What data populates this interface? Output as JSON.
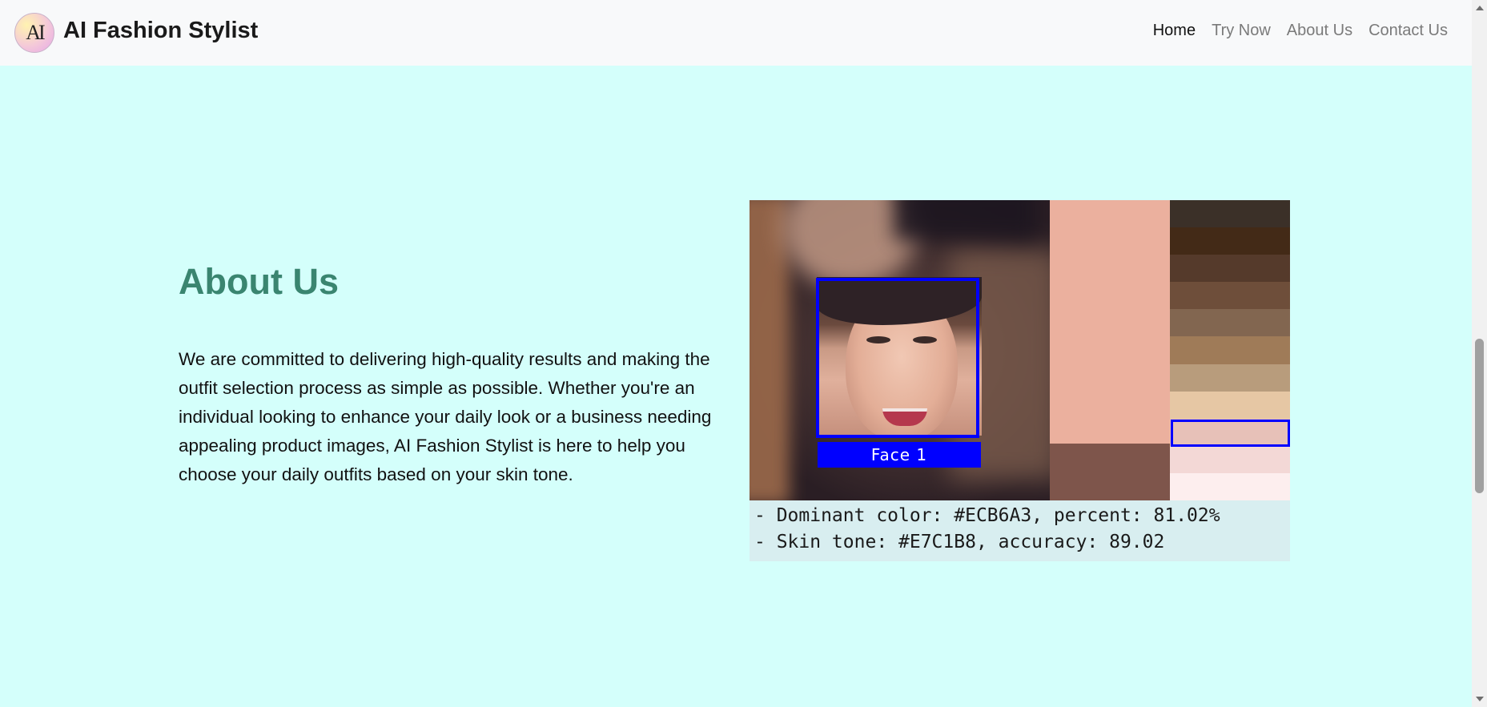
{
  "header": {
    "logo_text": "AI",
    "brand": "AI Fashion Stylist",
    "nav": [
      {
        "label": "Home",
        "active": true
      },
      {
        "label": "Try Now",
        "active": false
      },
      {
        "label": "About Us",
        "active": false
      },
      {
        "label": "Contact Us",
        "active": false
      }
    ]
  },
  "about": {
    "heading": "About Us",
    "paragraph": "We are committed to delivering high-quality results and making the outfit selection process as simple as possible. Whether you're an individual looking to enhance your daily look or a business needing appealing product images, AI Fashion Stylist is here to help you choose your daily outfits based on your skin tone."
  },
  "analysis": {
    "face_label": "Face 1",
    "dominant_color": "#ECB6A3",
    "secondary_color": "#7E554B",
    "palette": [
      "#3b3028",
      "#432a17",
      "#553a2b",
      "#6e4e3a",
      "#826650",
      "#9f7b58",
      "#b89c7c",
      "#e6c7a4",
      "#e7c1b8",
      "#f3d8d6",
      "#fdeeee"
    ],
    "highlighted_swatch": "#E7C1B8",
    "lines": [
      "- Dominant color: #ECB6A3, percent: 81.02%",
      "- Skin tone: #E7C1B8, accuracy: 89.02"
    ]
  },
  "colors": {
    "page_bg": "#d4fffb",
    "heading": "#3a8570",
    "navbar_bg": "#f8f9fa",
    "box": "#0000ff"
  }
}
